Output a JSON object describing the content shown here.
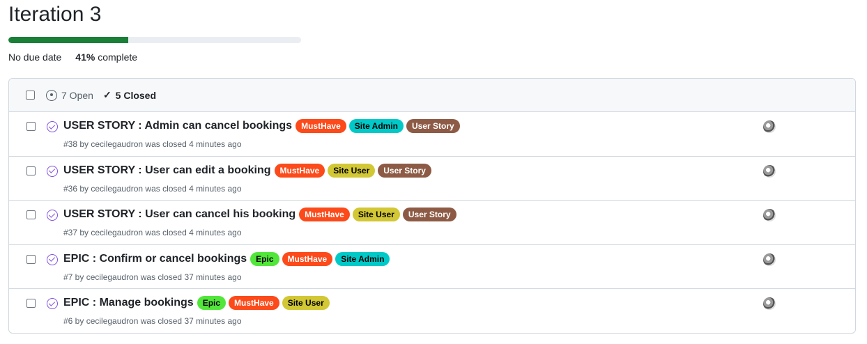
{
  "milestone": {
    "title": "Iteration 3",
    "due": "No due date",
    "percent": "41%",
    "percent_suffix": "complete",
    "progress_fraction": 0.41
  },
  "header": {
    "open_label": "7 Open",
    "closed_label": "5 Closed"
  },
  "colors": {
    "progress": "#1a7f37",
    "closed_icon": "#8250df"
  },
  "issues": [
    {
      "title": "USER STORY : Admin can cancel bookings",
      "meta": "#38 by cecilegaudron was closed 4 minutes ago",
      "labels": [
        {
          "name": "MustHave",
          "bg": "#fc4a1a",
          "fg": "#ffffff"
        },
        {
          "name": "Site Admin",
          "bg": "#00c9c8",
          "fg": "#000000"
        },
        {
          "name": "User Story",
          "bg": "#8d5b45",
          "fg": "#ffffff"
        }
      ]
    },
    {
      "title": "USER STORY : User can edit a booking",
      "meta": "#36 by cecilegaudron was closed 4 minutes ago",
      "labels": [
        {
          "name": "MustHave",
          "bg": "#fc4a1a",
          "fg": "#ffffff"
        },
        {
          "name": "Site User",
          "bg": "#d2c734",
          "fg": "#000000"
        },
        {
          "name": "User Story",
          "bg": "#8d5b45",
          "fg": "#ffffff"
        }
      ]
    },
    {
      "title": "USER STORY : User can cancel his booking",
      "meta": "#37 by cecilegaudron was closed 4 minutes ago",
      "labels": [
        {
          "name": "MustHave",
          "bg": "#fc4a1a",
          "fg": "#ffffff"
        },
        {
          "name": "Site User",
          "bg": "#d2c734",
          "fg": "#000000"
        },
        {
          "name": "User Story",
          "bg": "#8d5b45",
          "fg": "#ffffff"
        }
      ]
    },
    {
      "title": "EPIC : Confirm or cancel bookings",
      "meta": "#7 by cecilegaudron was closed 37 minutes ago",
      "labels": [
        {
          "name": "Epic",
          "bg": "#52e63a",
          "fg": "#000000"
        },
        {
          "name": "MustHave",
          "bg": "#fc4a1a",
          "fg": "#ffffff"
        },
        {
          "name": "Site Admin",
          "bg": "#00c9c8",
          "fg": "#000000"
        }
      ]
    },
    {
      "title": "EPIC : Manage bookings",
      "meta": "#6 by cecilegaudron was closed 37 minutes ago",
      "labels": [
        {
          "name": "Epic",
          "bg": "#52e63a",
          "fg": "#000000"
        },
        {
          "name": "MustHave",
          "bg": "#fc4a1a",
          "fg": "#ffffff"
        },
        {
          "name": "Site User",
          "bg": "#d2c734",
          "fg": "#000000"
        }
      ]
    }
  ]
}
